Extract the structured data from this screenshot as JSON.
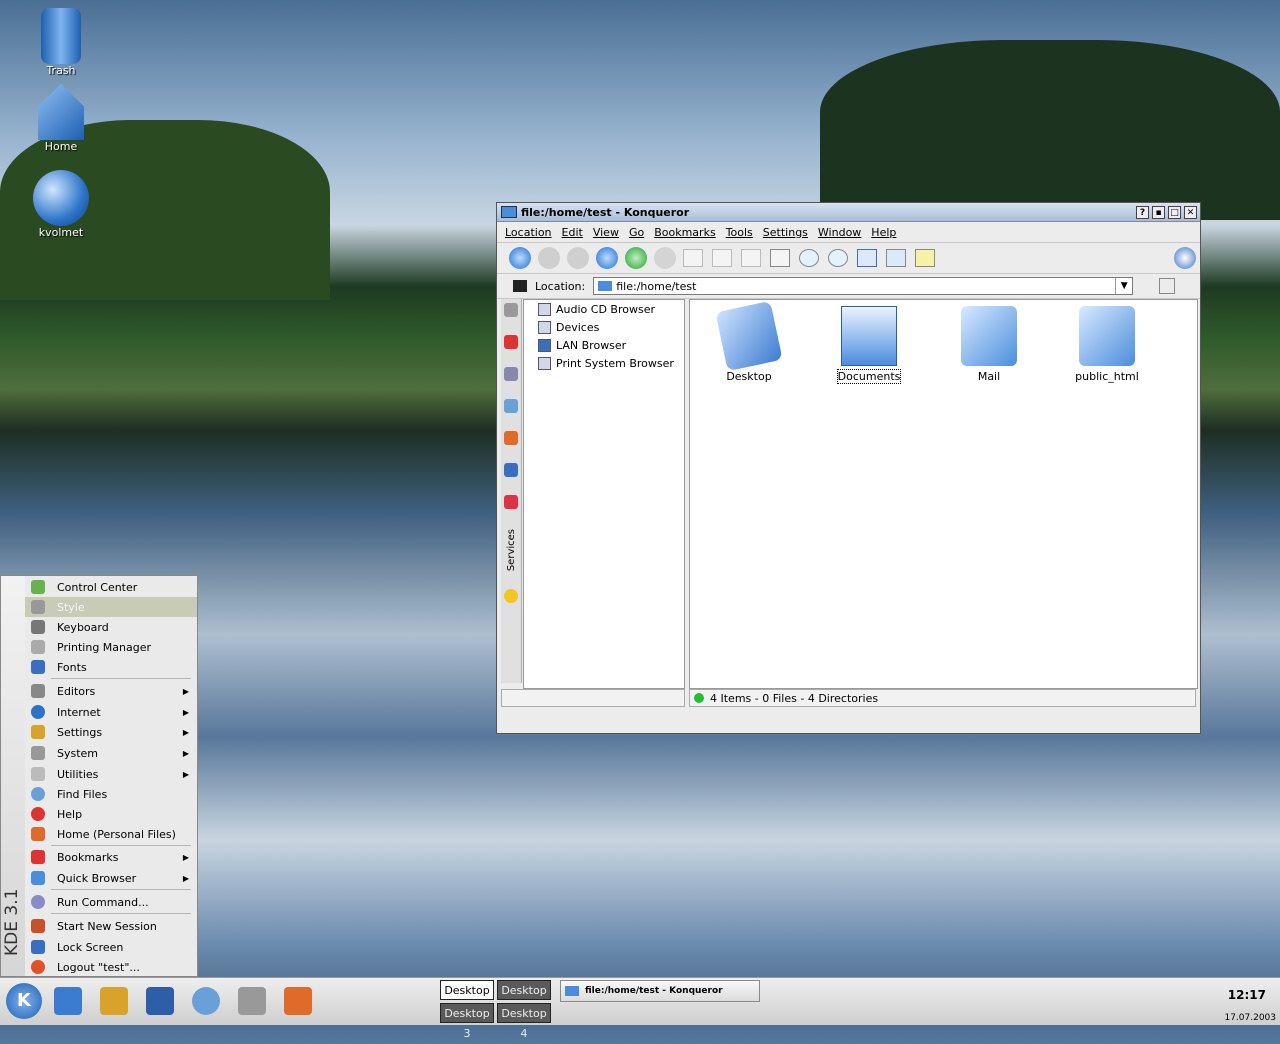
{
  "desktop": {
    "icons": [
      {
        "label": "Trash",
        "icon": "trash-icon"
      },
      {
        "label": "Home",
        "icon": "home-icon"
      },
      {
        "label": "kvolmet",
        "icon": "globe-icon"
      }
    ]
  },
  "window": {
    "title": "file:/home/test - Konqueror",
    "menu": [
      "Location",
      "Edit",
      "View",
      "Go",
      "Bookmarks",
      "Tools",
      "Settings",
      "Window",
      "Help"
    ],
    "location_label": "Location:",
    "location_value": "file:/home/test",
    "tree_items": [
      "Audio CD Browser",
      "Devices",
      "LAN Browser",
      "Print System Browser"
    ],
    "sidebar_tab_label": "Services",
    "files": [
      "Desktop",
      "Documents",
      "Mail",
      "public_html"
    ],
    "status_text": "4 Items - 0 Files - 4 Directories",
    "colors": {
      "title_bg": "#a9bdd8",
      "folder": "#4b8ddd"
    }
  },
  "kmenu": {
    "brand": "KDE 3.1",
    "items": [
      {
        "label": "Control Center",
        "icon": "control-center-icon"
      },
      {
        "label": "Style",
        "icon": "style-icon",
        "highlighted": true
      },
      {
        "label": "Keyboard",
        "icon": "keyboard-icon"
      },
      {
        "label": "Printing Manager",
        "icon": "printer-icon"
      },
      {
        "label": "Fonts",
        "icon": "fonts-icon"
      },
      {
        "label": "Editors",
        "icon": "editors-icon",
        "submenu": true
      },
      {
        "label": "Internet",
        "icon": "internet-icon",
        "submenu": true
      },
      {
        "label": "Settings",
        "icon": "settings-icon",
        "submenu": true
      },
      {
        "label": "System",
        "icon": "system-icon",
        "submenu": true
      },
      {
        "label": "Utilities",
        "icon": "utilities-icon",
        "submenu": true
      },
      {
        "label": "Find Files",
        "icon": "find-icon"
      },
      {
        "label": "Help",
        "icon": "help-icon"
      },
      {
        "label": "Home (Personal Files)",
        "icon": "home-icon"
      },
      {
        "label": "Bookmarks",
        "icon": "bookmarks-icon",
        "submenu": true
      },
      {
        "label": "Quick Browser",
        "icon": "quick-browser-icon",
        "submenu": true
      },
      {
        "label": "Run Command...",
        "icon": "run-icon"
      },
      {
        "label": "Start New Session",
        "icon": "session-icon"
      },
      {
        "label": "Lock Screen",
        "icon": "lock-icon"
      },
      {
        "label": "Logout \"test\"...",
        "icon": "logout-icon"
      }
    ]
  },
  "taskbar": {
    "k_label": "K",
    "desktops": [
      "Desktop 1",
      "Desktop 2",
      "Desktop 3",
      "Desktop 4"
    ],
    "task": "file:/home/test - Konqueror",
    "time": "12:17",
    "date": "17.07.2003"
  }
}
